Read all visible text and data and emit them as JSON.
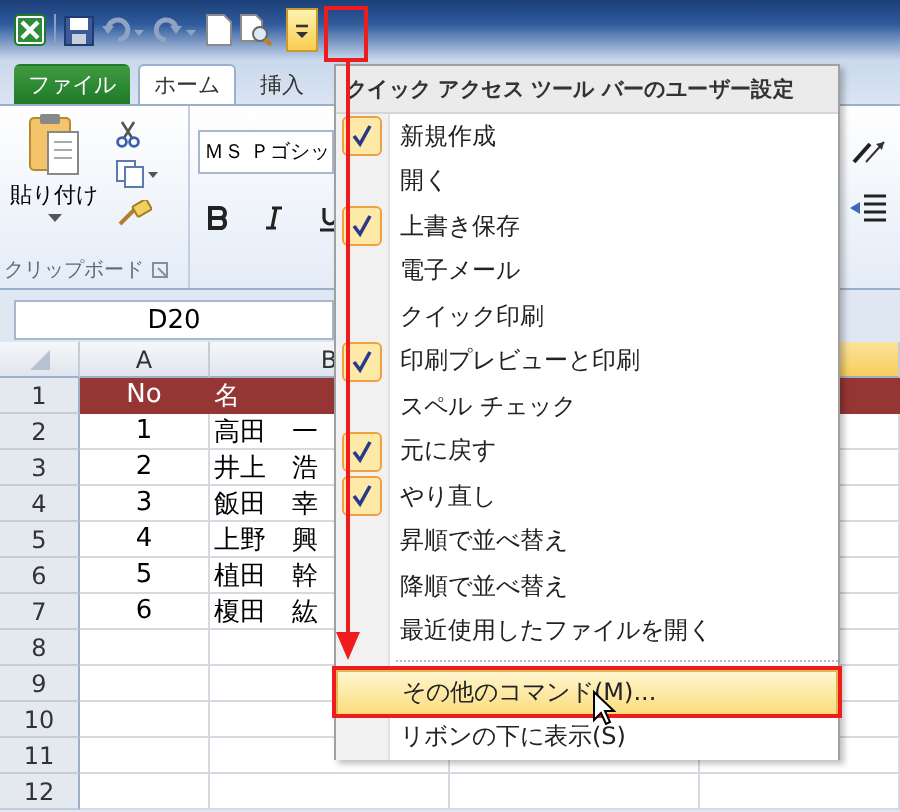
{
  "tabs": [
    {
      "label": "ファイル",
      "kind": "file",
      "selected": false
    },
    {
      "label": "ホーム",
      "kind": "tab",
      "selected": true
    },
    {
      "label": "挿入",
      "kind": "tab",
      "selected": false
    }
  ],
  "ribbon": {
    "paste_label": "貼り付け",
    "clipboard_group": "クリップボード",
    "font_name": "ＭＳ Ｐゴシッ"
  },
  "name_box": "D20",
  "columns": [
    {
      "label": "A"
    },
    {
      "label": "B"
    }
  ],
  "rows": [
    {
      "number": "1",
      "kind": "header",
      "no": "No",
      "name": "名"
    },
    {
      "number": "2",
      "kind": "data",
      "no": "1",
      "name": "高田　一"
    },
    {
      "number": "3",
      "kind": "data",
      "no": "2",
      "name": "井上　浩"
    },
    {
      "number": "4",
      "kind": "data",
      "no": "3",
      "name": "飯田　幸"
    },
    {
      "number": "5",
      "kind": "data",
      "no": "4",
      "name": "上野　興"
    },
    {
      "number": "6",
      "kind": "data",
      "no": "5",
      "name": "植田　幹"
    },
    {
      "number": "7",
      "kind": "data",
      "no": "6",
      "name": "榎田　紘"
    },
    {
      "number": "8",
      "kind": "data"
    },
    {
      "number": "9",
      "kind": "data"
    },
    {
      "number": "10",
      "kind": "data"
    },
    {
      "number": "11",
      "kind": "data"
    },
    {
      "number": "12",
      "kind": "data"
    }
  ],
  "menu": {
    "title": "クイック アクセス ツール バーのユーザー設定",
    "items": [
      {
        "label": "新規作成",
        "checked": true
      },
      {
        "label": "開く",
        "checked": false
      },
      {
        "label": "上書き保存",
        "checked": true
      },
      {
        "label": "電子メール",
        "checked": false
      },
      {
        "label": "クイック印刷",
        "checked": false
      },
      {
        "label": "印刷プレビューと印刷",
        "checked": true
      },
      {
        "label": "スペル チェック",
        "checked": false
      },
      {
        "label": "元に戻す",
        "checked": true
      },
      {
        "label": "やり直し",
        "checked": true
      },
      {
        "label": "昇順で並べ替え",
        "checked": false
      },
      {
        "label": "降順で並べ替え",
        "checked": false
      },
      {
        "label": "最近使用したファイルを開く",
        "checked": false
      }
    ],
    "commands": [
      {
        "label": "その他のコマンド(M)...",
        "selected": true
      },
      {
        "label": "リボンの下に表示(S)",
        "selected": false
      }
    ]
  }
}
